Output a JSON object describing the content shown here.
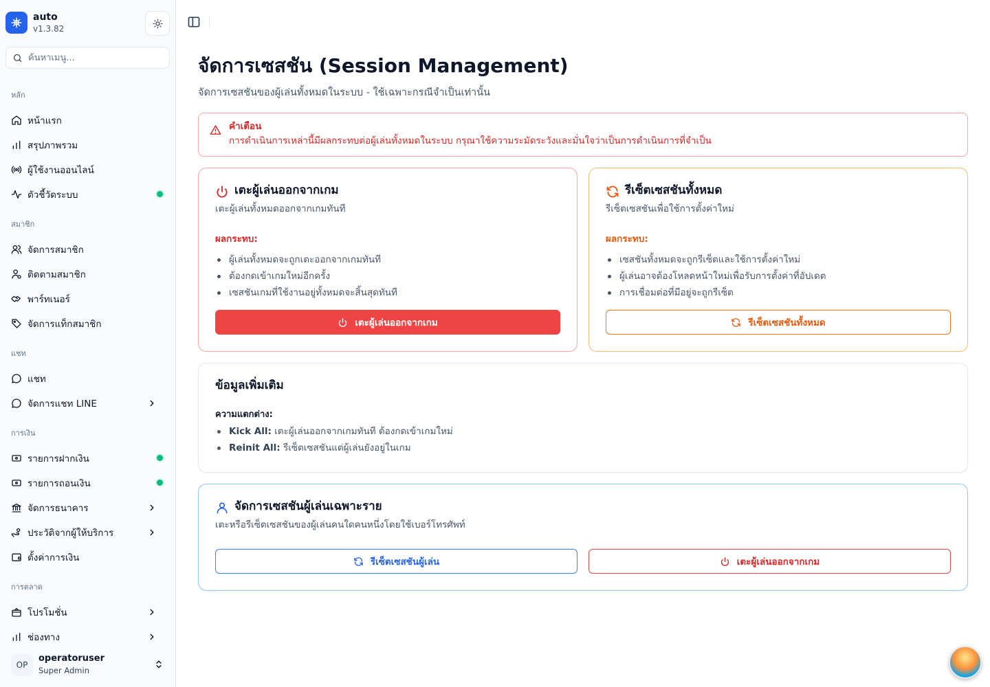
{
  "brand": {
    "name": "auto",
    "version": "v1.3.82"
  },
  "search": {
    "placeholder": "ค้นหาเมนู..."
  },
  "sidebar": {
    "groups": [
      {
        "label": "หลัก",
        "items": [
          {
            "label": "หน้าแรก",
            "icon": "home-icon"
          },
          {
            "label": "สรุปภาพรวม",
            "icon": "bar-chart-icon"
          },
          {
            "label": "ผู้ใช้งานออนไลน์",
            "icon": "radio-icon"
          },
          {
            "label": "ตัวชี้วัดระบบ",
            "icon": "activity-icon",
            "status_dot": true
          }
        ]
      },
      {
        "label": "สมาชิก",
        "items": [
          {
            "label": "จัดการสมาชิก",
            "icon": "users-icon"
          },
          {
            "label": "ติดตามสมาชิก",
            "icon": "user-search-icon"
          },
          {
            "label": "พาร์ทเนอร์",
            "icon": "handshake-icon"
          },
          {
            "label": "จัดการแท็กสมาชิก",
            "icon": "tag-icon"
          }
        ]
      },
      {
        "label": "แชท",
        "items": [
          {
            "label": "แชท",
            "icon": "message-circle-icon"
          },
          {
            "label": "จัดการแชท LINE",
            "icon": "message-circle-icon",
            "has_submenu": true
          }
        ]
      },
      {
        "label": "การเงิน",
        "items": [
          {
            "label": "รายการฝากเงิน",
            "icon": "deposit-icon",
            "status_dot": true
          },
          {
            "label": "รายการถอนเงิน",
            "icon": "withdraw-icon",
            "status_dot": true
          },
          {
            "label": "จัดการธนาคาร",
            "icon": "bank-icon",
            "has_submenu": true
          },
          {
            "label": "ประวัติจากผู้ให้บริการ",
            "icon": "hand-coins-icon",
            "has_submenu": true
          },
          {
            "label": "ตั้งค่าการเงิน",
            "icon": "wallet-icon"
          }
        ]
      },
      {
        "label": "การตลาด",
        "items": [
          {
            "label": "โปรโมชั่น",
            "icon": "gift-icon",
            "has_submenu": true
          },
          {
            "label": "ช่องทาง",
            "icon": "bar-chart-icon",
            "has_submenu": true
          }
        ]
      }
    ]
  },
  "user": {
    "initials": "OP",
    "name": "operatoruser",
    "role": "Super Admin"
  },
  "page": {
    "title": "จัดการเซสชัน (Session Management)",
    "subtitle": "จัดการเซสชันของผู้เล่นทั้งหมดในระบบ - ใช้เฉพาะกรณีจำเป็นเท่านั้น",
    "warning": {
      "title": "คำเตือน",
      "text": "การดำเนินการเหล่านี้มีผลกระทบต่อผู้เล่นทั้งหมดในระบบ กรุณาใช้ความระมัดระวังและมั่นใจว่าเป็นการดำเนินการที่จำเป็น"
    },
    "kick_card": {
      "title": "เตะผู้เล่นออกจากเกม",
      "desc": "เตะผู้เล่นทั้งหมดออกจากเกมทันที",
      "impact_label": "ผลกระทบ:",
      "impacts": [
        "ผู้เล่นทั้งหมดจะถูกเตะออกจากเกมทันที",
        "ต้องกดเข้าเกมใหม่อีกครั้ง",
        "เซสชันเกมที่ใช้งานอยู่ทั้งหมดจะสิ้นสุดทันที"
      ],
      "button": "เตะผู้เล่นออกจากเกม"
    },
    "reset_card": {
      "title": "รีเซ็ตเซสชันทั้งหมด",
      "desc": "รีเซ็ตเซสชันเพื่อใช้การตั้งค่าใหม่",
      "impact_label": "ผลกระทบ:",
      "impacts": [
        "เซสชันทั้งหมดจะถูกรีเซ็ตและใช้การตั้งค่าใหม่",
        "ผู้เล่นอาจต้องโหลดหน้าใหม่เพื่อรับการตั้งค่าที่อัปเดต",
        "การเชื่อมต่อที่มีอยู่จะถูกรีเซ็ต"
      ],
      "button": "รีเซ็ตเซสชันทั้งหมด"
    },
    "info_card": {
      "title": "ข้อมูลเพิ่มเติม",
      "diff_label": "ความแตกต่าง:",
      "items": [
        {
          "term": "Kick All:",
          "text": "เตะผู้เล่นออกจากเกมทันที ต้องกดเข้าเกมใหม่"
        },
        {
          "term": "Reinit All:",
          "text": "รีเซ็ตเซสชันแต่ผู้เล่นยังอยู่ในเกม"
        }
      ]
    },
    "single_card": {
      "title": "จัดการเซสชันผู้เล่นเฉพาะราย",
      "desc": "เตะหรือรีเซ็ตเซสชันของผู้เล่นคนใดคนหนึ่งโดยใช้เบอร์โทรศัพท์",
      "reset_button": "รีเซ็ตเซสชันผู้เล่น",
      "kick_button": "เตะผู้เล่นออกจากเกม"
    }
  },
  "colors": {
    "brand": "#2563eb",
    "danger": "#ef4444",
    "warning": "#ea580c",
    "info": "#2563eb",
    "online": "#10b981"
  }
}
